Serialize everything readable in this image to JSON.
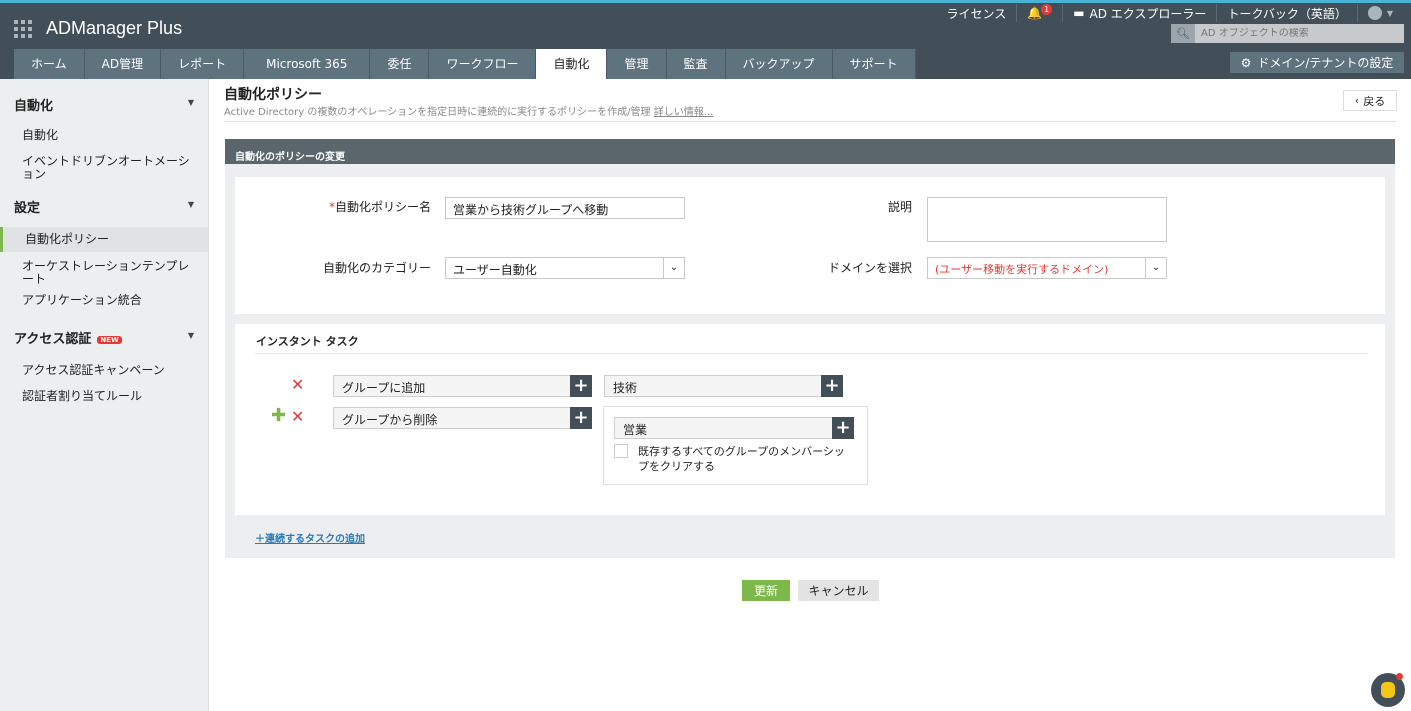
{
  "header": {
    "app_name": "ADManager Plus",
    "license": "ライセンス",
    "notification_count": "1",
    "ad_explorer": "AD エクスプローラー",
    "talkback": "トークバック（英語）",
    "search_placeholder": "AD オブジェクトの検索",
    "domain_settings": "ドメイン/テナントの設定"
  },
  "tabs": [
    {
      "label": "ホーム"
    },
    {
      "label": "AD管理"
    },
    {
      "label": "レポート"
    },
    {
      "label": "Microsoft 365"
    },
    {
      "label": "委任"
    },
    {
      "label": "ワークフロー"
    },
    {
      "label": "自動化",
      "active": true
    },
    {
      "label": "管理"
    },
    {
      "label": "監査"
    },
    {
      "label": "バックアップ"
    },
    {
      "label": "サポート"
    }
  ],
  "sidebar": {
    "sec1": "自動化",
    "item1": "自動化",
    "item2": "イベントドリブンオートメーション",
    "sec2": "設定",
    "item3": "自動化ポリシー",
    "item4": "オーケストレーションテンプレート",
    "item5": "アプリケーション統合",
    "sec3": "アクセス認証",
    "new_badge": "NEW",
    "item6": "アクセス認証キャンペーン",
    "item7": "認証者割り当てルール"
  },
  "page": {
    "title": "自動化ポリシー",
    "subtitle": "Active Directory の複数のオペレーションを指定日時に連続的に実行するポリシーを作成/管理",
    "more_info": "詳しい情報...",
    "back": "戻る",
    "panel_title": "自動化のポリシーの変更"
  },
  "form": {
    "name_label": "自動化ポリシー名",
    "name_value": "営業から技術グループへ移動",
    "desc_label": "説明",
    "desc_value": "",
    "category_label": "自動化のカテゴリー",
    "category_value": "ユーザー自動化",
    "domain_label": "ドメインを選択",
    "domain_value": "(ユーザー移動を実行するドメイン)",
    "accent_red": "#e53935"
  },
  "tasks": {
    "title": "インスタント タスク",
    "task1": "グループに追加",
    "task1_group": "技術",
    "task2": "グループから削除",
    "task2_group": "営業",
    "clear_label": "既存するすべてのグループのメンバーシップをクリアする",
    "add_link": "＋連続するタスクの追加"
  },
  "actions": {
    "update": "更新",
    "cancel": "キャンセル"
  }
}
